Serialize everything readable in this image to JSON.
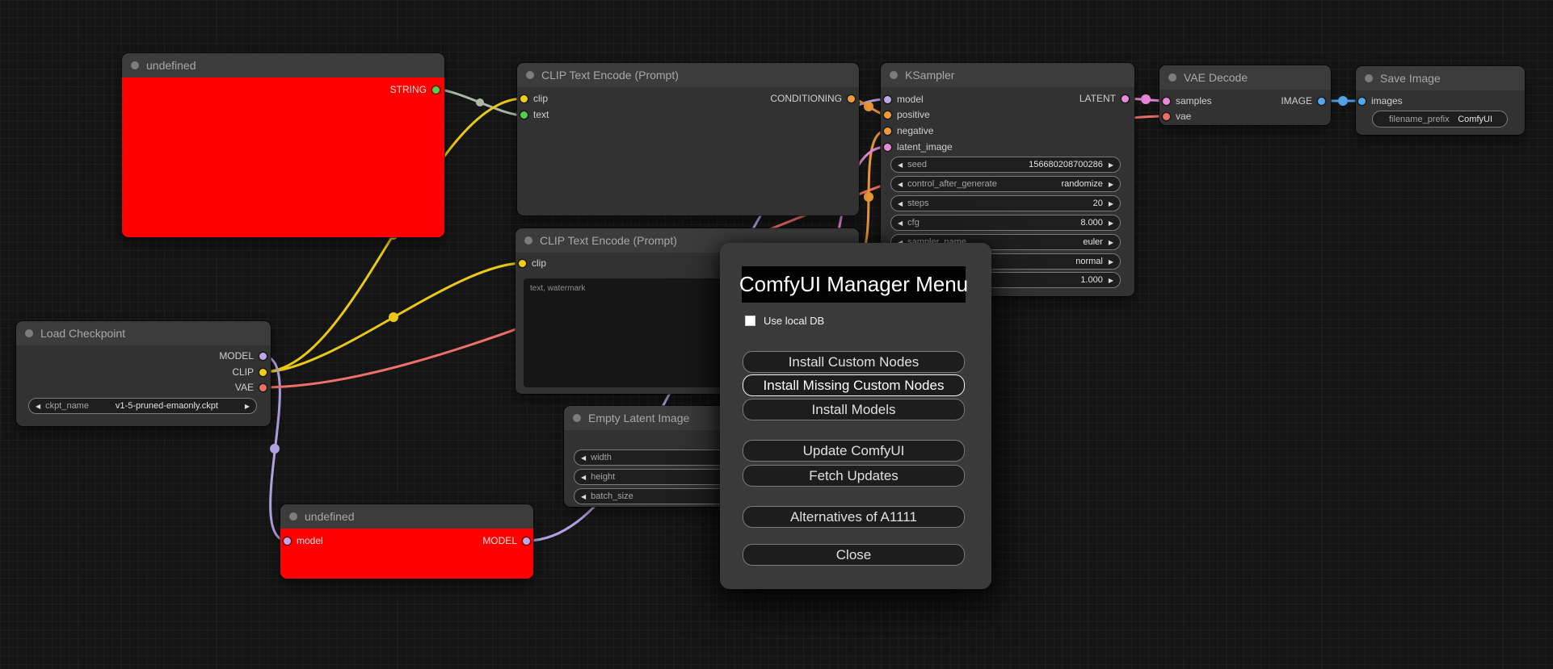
{
  "colors": {
    "wire_string": "#aab8a4",
    "wire_clip": "#e9c913",
    "wire_model": "#b3a0e0",
    "wire_vae": "#ef7168",
    "wire_cond": "#f09b38",
    "wire_latent": "#e88ad8",
    "wire_image": "#55a6ec",
    "node_error_red": "#ff0000"
  },
  "icons": {
    "arrow_left": "◀",
    "arrow_right": "▶"
  },
  "nodes": {
    "undefined_top": {
      "title": "undefined",
      "output": "STRING"
    },
    "clip_encode_1": {
      "title": "CLIP Text Encode (Prompt)",
      "input_clip": "clip",
      "input_text": "text",
      "output": "CONDITIONING"
    },
    "clip_encode_2": {
      "title": "CLIP Text Encode (Prompt)",
      "input_clip": "clip",
      "prompt_text": "text, watermark"
    },
    "empty_latent": {
      "title": "Empty Latent Image",
      "widgets": [
        {
          "label": "width"
        },
        {
          "label": "height"
        },
        {
          "label": "batch_size"
        }
      ]
    },
    "ksampler": {
      "title": "KSampler",
      "inputs": {
        "model": "model",
        "positive": "positive",
        "negative": "negative",
        "latent_image": "latent_image"
      },
      "output": "LATENT",
      "widgets": [
        {
          "label": "seed",
          "value": "156680208700286"
        },
        {
          "label": "control_after_generate",
          "value": "randomize"
        },
        {
          "label": "steps",
          "value": "20"
        },
        {
          "label": "cfg",
          "value": "8.000"
        },
        {
          "label": "sampler_name",
          "value": "euler"
        },
        {
          "label": "",
          "value": "normal"
        },
        {
          "label": "",
          "value": "1.000"
        }
      ]
    },
    "load_checkpoint": {
      "title": "Load Checkpoint",
      "outputs": {
        "model": "MODEL",
        "clip": "CLIP",
        "vae": "VAE"
      },
      "widget": {
        "label": "ckpt_name",
        "value": "v1-5-pruned-emaonly.ckpt"
      }
    },
    "undefined_bottom": {
      "title": "undefined",
      "input": "model",
      "output": "MODEL"
    },
    "vae_decode": {
      "title": "VAE Decode",
      "inputs": {
        "samples": "samples",
        "vae": "vae"
      },
      "output": "IMAGE"
    },
    "save_image": {
      "title": "Save Image",
      "input": "images",
      "widget": {
        "label": "filename_prefix",
        "value": "ComfyUI"
      }
    }
  },
  "dialog": {
    "title": "ComfyUI Manager Menu",
    "checkbox_label": "Use local DB",
    "buttons": [
      "Install Custom Nodes",
      "Install Missing Custom Nodes",
      "Install Models",
      "Update ComfyUI",
      "Fetch Updates",
      "Alternatives of A1111",
      "Close"
    ]
  }
}
